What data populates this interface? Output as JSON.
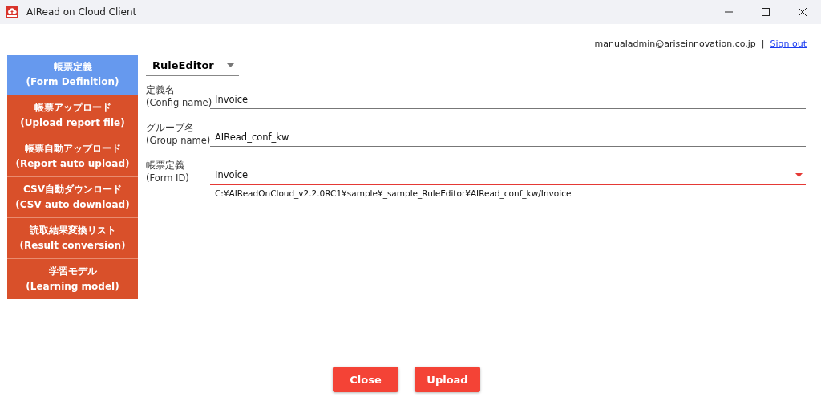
{
  "window": {
    "title": "AIRead on Cloud Client"
  },
  "user": {
    "email": "manualadmin@ariseinnovation.co.jp",
    "separator": "|",
    "sign_out": "Sign out"
  },
  "sidebar": {
    "items": [
      {
        "label_ja": "帳票定義",
        "label_en": "(Form Definition)",
        "selected": true
      },
      {
        "label_ja": "帳票アップロード",
        "label_en": "(Upload report file)",
        "selected": false
      },
      {
        "label_ja": "帳票自動アップロード",
        "label_en": "(Report auto upload)",
        "selected": false
      },
      {
        "label_ja": "CSV自動ダウンロード",
        "label_en": "(CSV auto download)",
        "selected": false
      },
      {
        "label_ja": "読取結果変換リスト",
        "label_en": "(Result conversion)",
        "selected": false
      },
      {
        "label_ja": "学習モデル",
        "label_en": "(Learning model)",
        "selected": false
      }
    ]
  },
  "mode_select": {
    "value": "RuleEditor"
  },
  "fields": [
    {
      "kind": "text",
      "label_ja": "定義名",
      "label_en": "(Config name)",
      "value": "Invoice",
      "focused": false
    },
    {
      "kind": "text",
      "label_ja": "グループ名",
      "label_en": "(Group name)",
      "value": "AIRead_conf_kw",
      "focused": false
    },
    {
      "kind": "select",
      "label_ja": "帳票定義",
      "label_en": "(Form ID)",
      "value": "Invoice",
      "focused": true,
      "path": "C:¥AIReadOnCloud_v2.2.0RC1¥sample¥_sample_RuleEditor¥AIRead_conf_kw/Invoice"
    }
  ],
  "buttons": [
    "Close",
    "Upload"
  ]
}
